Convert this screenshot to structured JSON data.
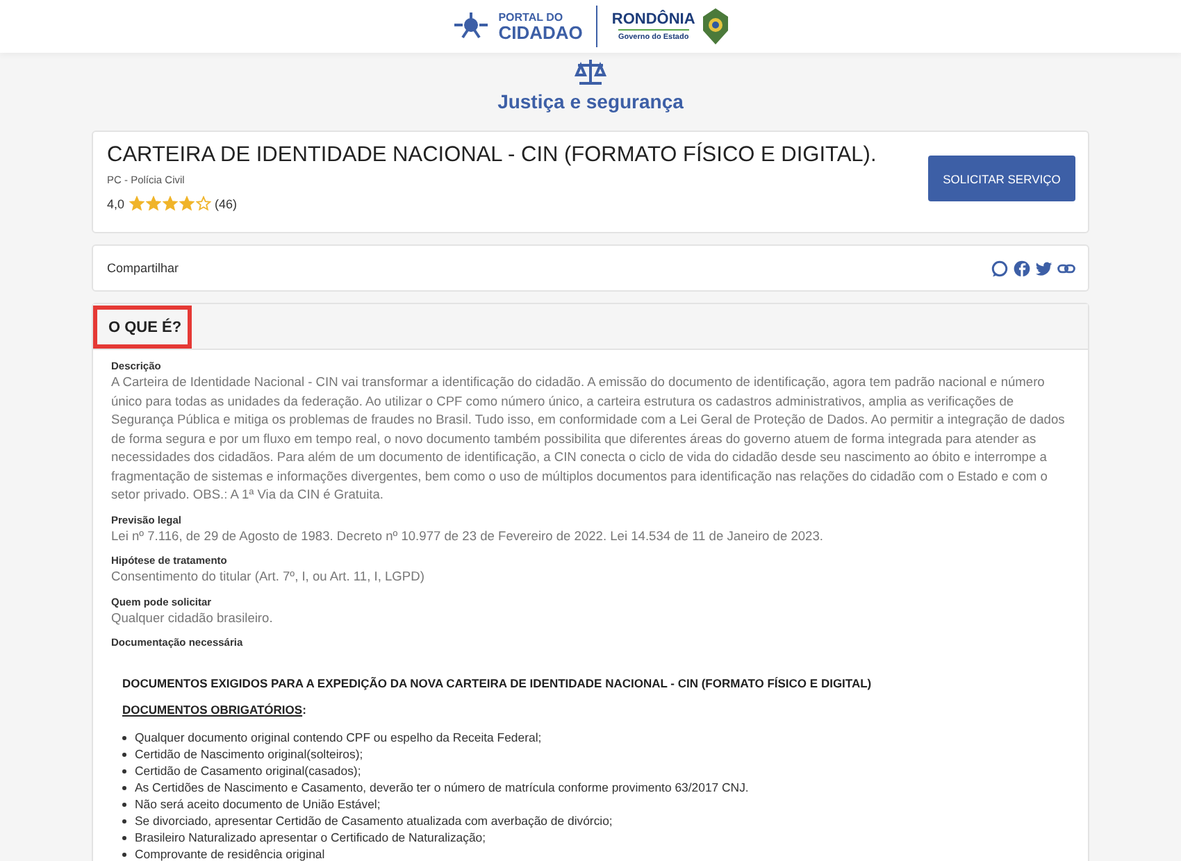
{
  "header": {
    "portal_logo_line1": "PORTAL DO",
    "portal_logo_line2": "CIDADAO",
    "state_logo_name": "RONDÔNIA",
    "state_logo_subtitle": "Governo do Estado"
  },
  "category": {
    "title": "Justiça e segurança"
  },
  "service": {
    "title": "CARTEIRA DE IDENTIDADE NACIONAL - CIN (FORMATO FÍSICO E DIGITAL).",
    "agency": "PC - Polícia Civil",
    "rating": "4,0",
    "stars": 4,
    "reviews": "(46)",
    "button": "SOLICITAR SERVIÇO"
  },
  "share": {
    "label": "Compartilhar"
  },
  "section": {
    "title": "O QUE É?",
    "highlighted": true,
    "fields": [
      {
        "label": "Descrição",
        "value": "A Carteira de Identidade Nacional - CIN vai transformar a identificação do cidadão. A emissão do documento de identificação, agora tem padrão nacional e número único para todas as unidades da federação. Ao utilizar o CPF como número único, a carteira estrutura os cadastros administrativos, amplia as verificações de Segurança Pública e mitiga os problemas de fraudes no Brasil. Tudo isso, em conformidade com a Lei Geral de Proteção de Dados. Ao permitir a integração de dados de forma segura e por um fluxo em tempo real, o novo documento também possibilita que diferentes áreas do governo atuem de forma integrada para atender as necessidades dos cidadãos. Para além de um documento de identificação, a CIN conecta o ciclo de vida do cidadão desde seu nascimento ao óbito e interrompe a fragmentação de sistemas e informações divergentes, bem como o uso de múltiplos documentos para identificação nas relações do cidadão com o Estado e com o setor privado. OBS.: A 1ª Via da CIN é Gratuita."
      },
      {
        "label": "Previsão legal",
        "value": "Lei nº 7.116, de 29 de Agosto de 1983. Decreto nº 10.977 de 23 de Fevereiro de 2022. Lei 14.534 de 11 de Janeiro de 2023."
      },
      {
        "label": "Hipótese de tratamento",
        "value": "Consentimento do titular (Art. 7º, I, ou Art. 11, I, LGPD)"
      },
      {
        "label": "Quem pode solicitar",
        "value": "Qualquer cidadão brasileiro."
      },
      {
        "label": "Documentação necessária"
      }
    ],
    "documents": {
      "heading": "DOCUMENTOS EXIGIDOS PARA A EXPEDIÇÃO DA NOVA CARTEIRA DE IDENTIDADE NACIONAL - CIN (FORMATO FÍSICO E DIGITAL)",
      "subheading": "DOCUMENTOS OBRIGATÓRIOS",
      "subheading_suffix": ":",
      "items": [
        "Qualquer documento original contendo CPF ou espelho da Receita Federal;",
        "Certidão de Nascimento original(solteiros);",
        "Certidão de Casamento original(casados);",
        "As Certidões de Nascimento e Casamento, deverão ter o número de matrícula conforme provimento 63/2017 CNJ.",
        "Não será aceito documento de União Estável;",
        "Se divorciado, apresentar Certidão de Casamento atualizada com averbação de divórcio;",
        "Brasileiro Naturalizado apresentar o Certificado de Naturalização;",
        "Comprovante de residência original"
      ]
    }
  }
}
